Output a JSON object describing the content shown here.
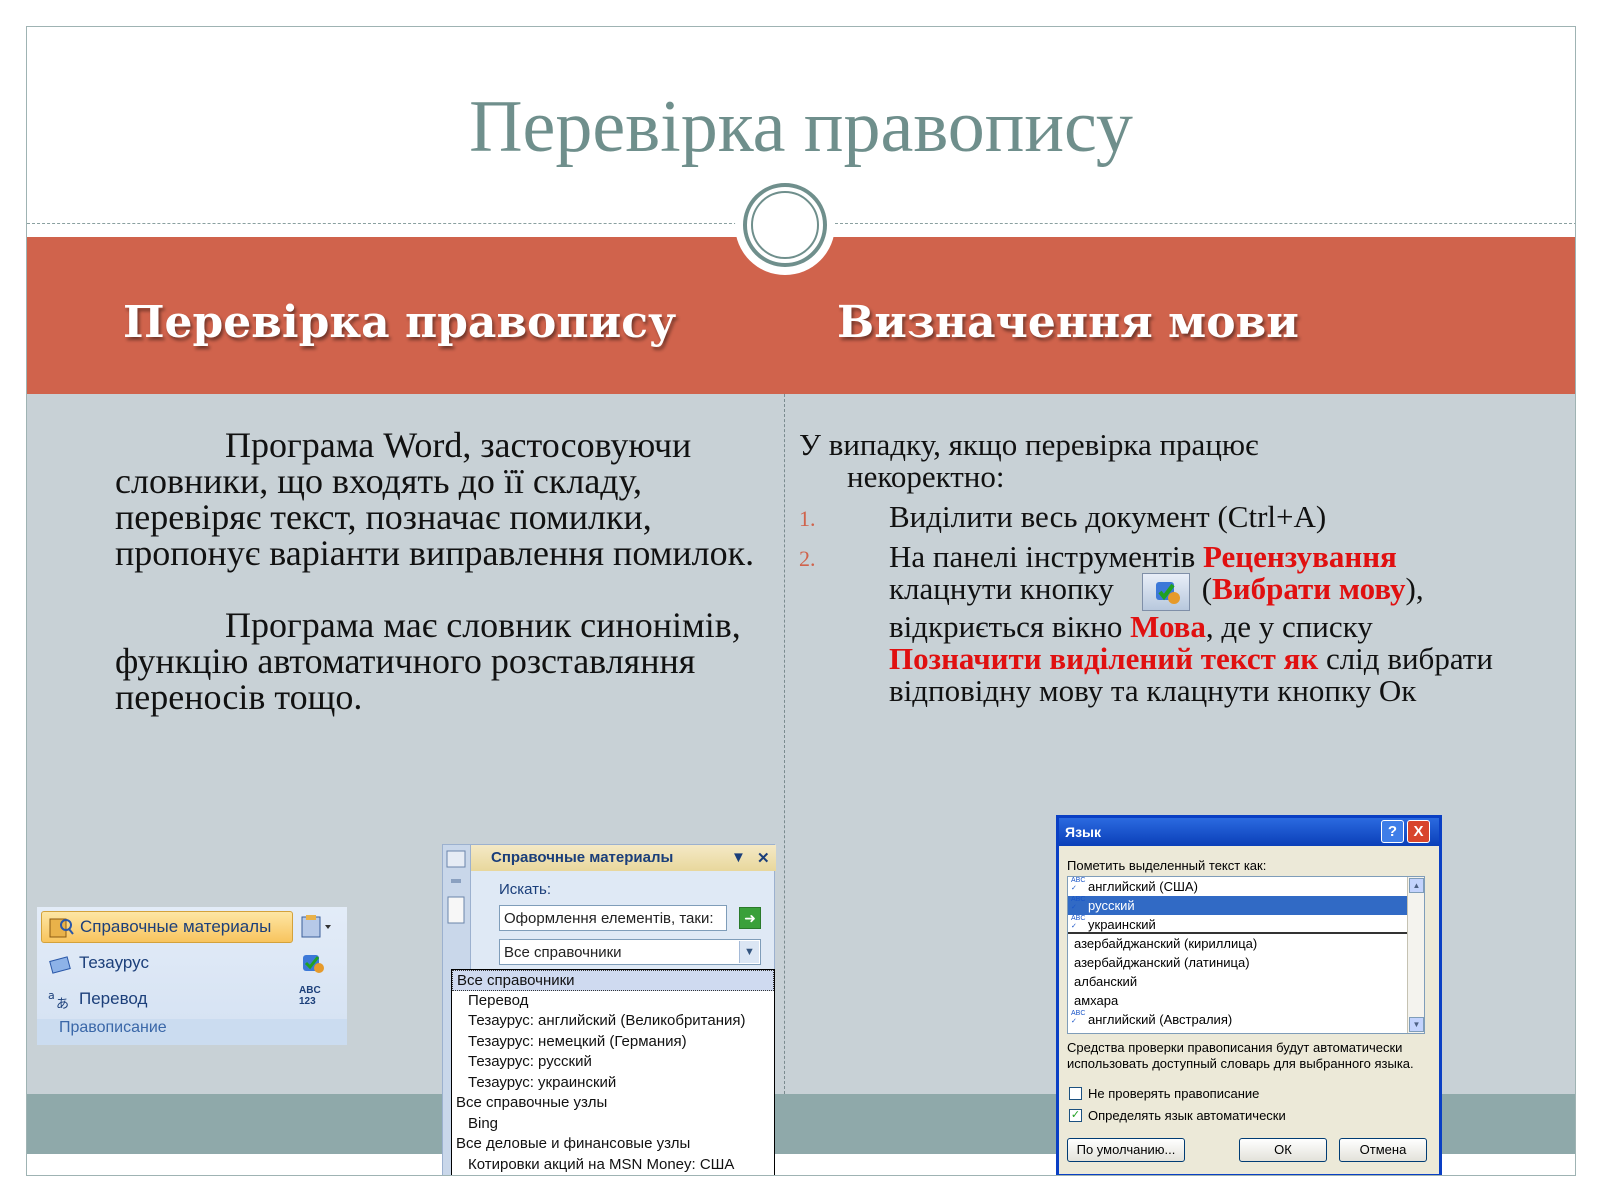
{
  "slide": {
    "title": "Перевірка правопису",
    "left_heading": "Перевірка правопису",
    "right_heading": "Визначення мови",
    "left_paragraphs": [
      "Програма  Word, застосовуючи словники, що входять до її складу, перевіряє текст, позначає помилки, пропонує варіанти виправлення помилок.",
      "Програма має словник синонімів, функцію автоматичного розставляння переносів тощо."
    ],
    "right_intro_line1": "У випадку, якщо перевірка  працює",
    "right_intro_line2": "некоректно:",
    "list": {
      "n1": "1.",
      "item1": "Виділити весь документ (Ctrl+A)",
      "n2": "2.",
      "item2_a": "На панелі інструментів ",
      "item2_red1": "Рецензування",
      "item2_b": "клацнути кнопку",
      "item2_paren_open": "(",
      "item2_red2": "Вибрати мову",
      "item2_c": "),",
      "item2_d": "відкриється вікно ",
      "item2_red3": "Мова",
      "item2_e": ", де у списку",
      "item2_red4": "Позначити виділений текст як",
      "item2_f": " слід вибрати відповідну мову та клацнути кнопку Ок"
    }
  },
  "ribbon": {
    "item1": "Справочные материалы",
    "item2": "Тезаурус",
    "item3": "Перевод",
    "abc_label": "ABC",
    "num_label": "123",
    "group_label": "Правописание"
  },
  "research_pane": {
    "title": "Справочные материалы",
    "search_label": "Искать:",
    "search_value": "Оформлення елементів, таки:",
    "source_value": "Все справочники",
    "options": [
      {
        "label": "Все справочники",
        "level": 0
      },
      {
        "label": "Перевод",
        "level": 1
      },
      {
        "label": "Тезаурус: английский (Великобритания)",
        "level": 1
      },
      {
        "label": "Тезаурус: немецкий (Германия)",
        "level": 1
      },
      {
        "label": "Тезаурус: русский",
        "level": 1
      },
      {
        "label": "Тезаурус: украинский",
        "level": 1
      },
      {
        "label": "Все справочные узлы",
        "level": 0
      },
      {
        "label": "Bing",
        "level": 1
      },
      {
        "label": "Все деловые и финансовые узлы",
        "level": 0
      },
      {
        "label": "Котировки акций на MSN Money: США",
        "level": 1
      }
    ]
  },
  "dialog": {
    "title": "Язык",
    "help": "?",
    "close": "X",
    "prompt": "Пометить выделенный текст как:",
    "languages": [
      {
        "label": "английский (США)",
        "top": true
      },
      {
        "label": "русский",
        "top": true,
        "selected": true
      },
      {
        "label": "украинский",
        "top": true,
        "separator": true
      },
      {
        "label": "азербайджанский (кириллица)"
      },
      {
        "label": "азербайджанский (латиница)"
      },
      {
        "label": "албанский"
      },
      {
        "label": "амхара"
      },
      {
        "label": "английский (Австралия)",
        "top": true
      }
    ],
    "note": "Средства проверки правописания будут автоматически использовать доступный словарь для выбранного языка.",
    "checkbox1": "Не проверять правописание",
    "checkbox1_checked": false,
    "checkbox2": "Определять язык автоматически",
    "checkbox2_checked": true,
    "btn_default": "По умолчанию...",
    "btn_ok": "ОК",
    "btn_cancel": "Отмена"
  },
  "colors": {
    "accent": "#d0634c",
    "title": "#6f8f8c",
    "content_bg": "#c8d1d6",
    "highlight_red": "#e01010"
  }
}
